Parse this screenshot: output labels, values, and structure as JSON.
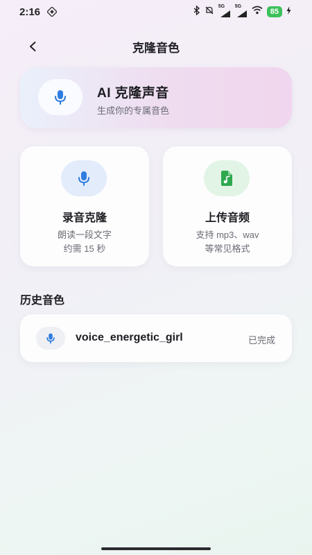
{
  "status_bar": {
    "time": "2:16",
    "signal_1": "5G",
    "signal_2": "5G",
    "battery": "85"
  },
  "header": {
    "title": "克隆音色",
    "back_icon": "chevron-left-icon"
  },
  "hero": {
    "title": "AI 克隆声音",
    "subtitle": "生成你的专属音色",
    "icon": "microphone-icon"
  },
  "options": [
    {
      "title": "录音克隆",
      "desc_line1": "朗读一段文字",
      "desc_line2": "约需 15 秒",
      "icon": "microphone-icon"
    },
    {
      "title": "上传音频",
      "desc_line1": "支持 mp3、wav",
      "desc_line2": "等常见格式",
      "icon": "music-file-icon"
    }
  ],
  "history": {
    "title": "历史音色",
    "items": [
      {
        "name": "voice_energetic_girl",
        "status": "已完成",
        "icon": "microphone-icon"
      }
    ]
  },
  "colors": {
    "accent_blue": "#2f7de0",
    "accent_green": "#2fa84f",
    "battery_green": "#3cc15a"
  }
}
